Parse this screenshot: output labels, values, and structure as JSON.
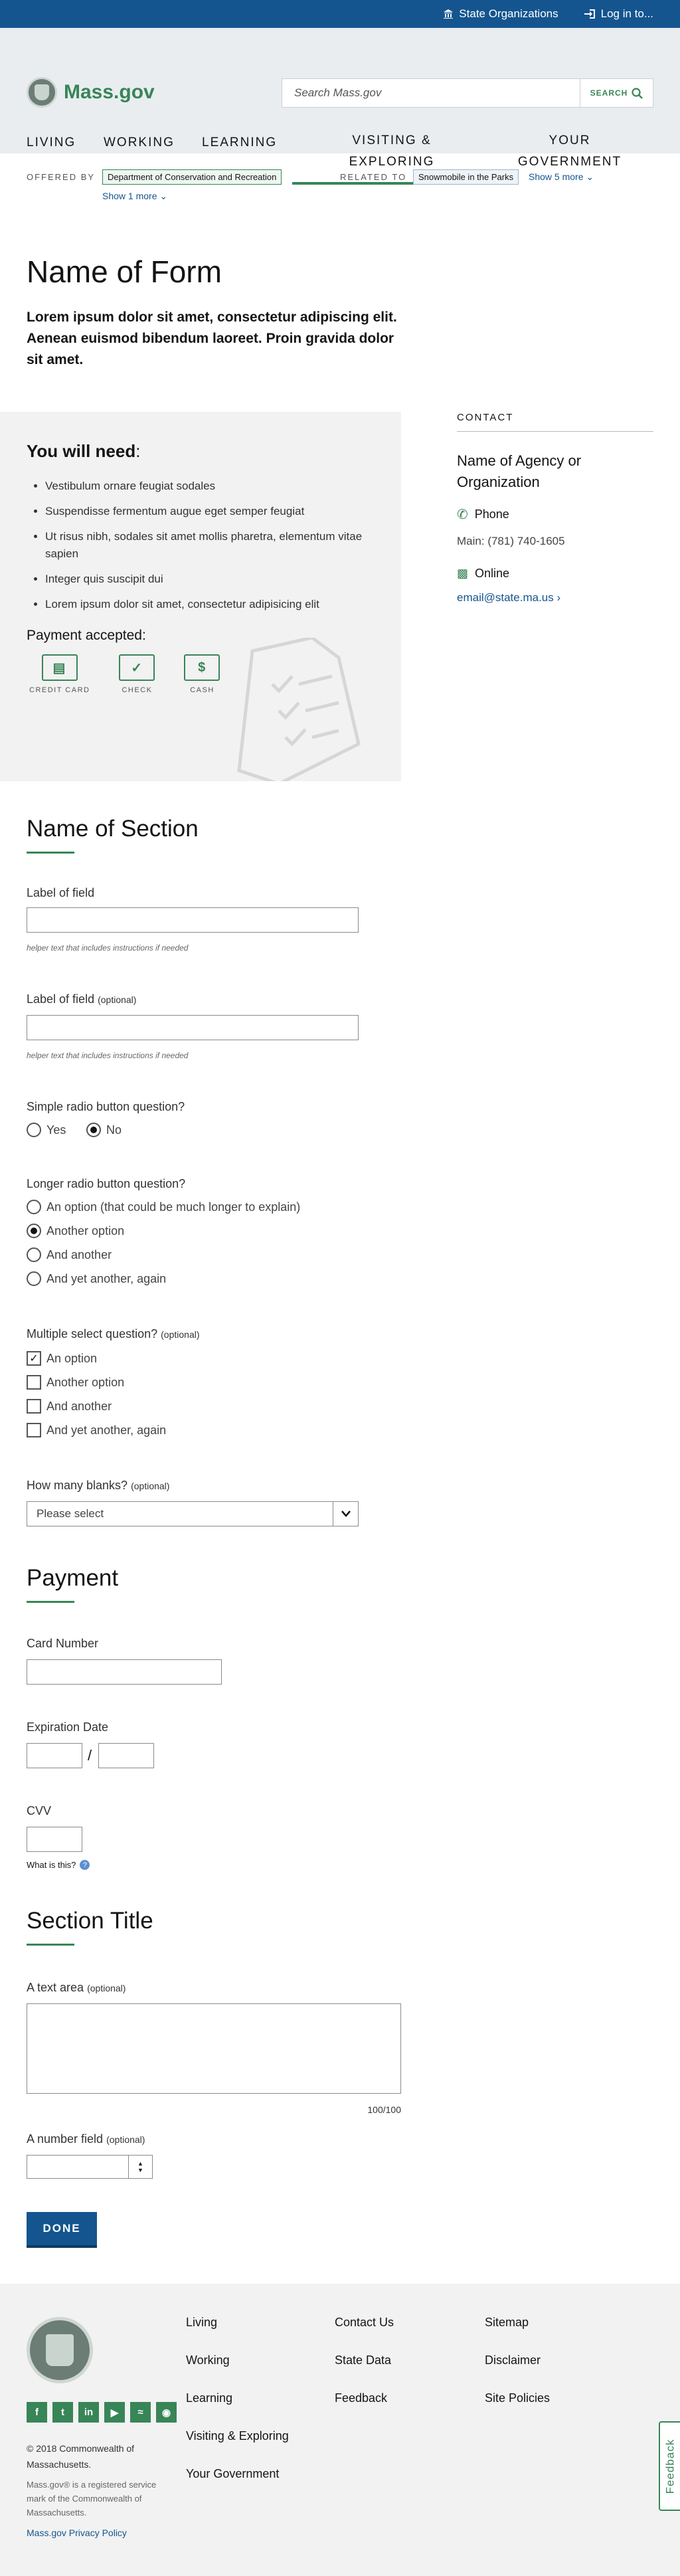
{
  "utility": {
    "state_orgs": "State Organizations",
    "login": "Log in to..."
  },
  "header": {
    "logo_text": "Mass.gov",
    "search_placeholder": "Search Mass.gov",
    "search_button": "SEARCH",
    "nav": [
      "LIVING",
      "WORKING",
      "LEARNING",
      "VISITING & EXPLORING",
      "YOUR GOVERNMENT"
    ]
  },
  "offered": {
    "label": "OFFERED BY",
    "org": "Department of Conservation and Recreation",
    "show_more": "Show 1 more",
    "related_label": "RELATED TO",
    "related": "Snowmobile in the Parks",
    "related_more": "Show 5 more"
  },
  "page": {
    "title": "Name of Form",
    "intro": "Lorem ipsum dolor sit amet, consectetur adipiscing elit. Aenean euismod bibendum laoreet. Proin gravida dolor sit amet."
  },
  "need": {
    "title": "You will need",
    "items": [
      "Vestibulum ornare feugiat sodales",
      "Suspendisse fermentum augue eget semper feugiat",
      "Ut risus nibh, sodales sit amet mollis pharetra, elementum vitae sapien",
      "Integer quis suscipit dui",
      "Lorem ipsum dolor sit amet, consectetur adipisicing elit"
    ],
    "payment_title": "Payment accepted",
    "payments": [
      "CREDIT CARD",
      "CHECK",
      "CASH"
    ]
  },
  "contact": {
    "title": "CONTACT",
    "agency": "Name of Agency or Organization",
    "phone_label": "Phone",
    "main_label": "Main:",
    "main_number": "(781) 740-1605",
    "online_label": "Online",
    "email": "email@state.ma.us"
  },
  "form": {
    "section1": "Name of Section",
    "field1_label": "Label of field",
    "field1_helper": "helper text that includes instructions if needed",
    "field2_label": "Label of field",
    "optional": "(optional)",
    "field2_helper": "helper text that includes instructions if needed",
    "simple_radio_q": "Simple radio button question?",
    "simple_radio_opts": [
      "Yes",
      "No"
    ],
    "long_radio_q": "Longer radio button question?",
    "long_radio_opts": [
      "An option (that could be much longer to explain)",
      "Another option",
      "And another",
      "And yet another, again"
    ],
    "multi_q": "Multiple select question?",
    "multi_opts": [
      "An option",
      "Another option",
      "And another",
      "And yet another, again"
    ],
    "blanks_q": "How many blanks?",
    "blanks_value": "Please select",
    "payment_section": "Payment",
    "card_label": "Card Number",
    "exp_label": "Expiration Date",
    "exp_sep": "/",
    "cvv_label": "CVV",
    "cvv_help": "What is this?",
    "section3": "Section Title",
    "textarea_label": "A text area",
    "textarea_count": "100/100",
    "number_label": "A number field",
    "done": "DONE"
  },
  "footer": {
    "col1": [
      "Living",
      "Working",
      "Learning",
      "Visiting & Exploring",
      "Your Government"
    ],
    "col2": [
      "Contact Us",
      "State Data",
      "Feedback"
    ],
    "col3": [
      "Sitemap",
      "Disclaimer",
      "Site Policies"
    ],
    "copyright": "© 2018 Commonwealth of Massachusetts.",
    "trademark": "Mass.gov® is a registered service mark of the Commonwealth of Massachusetts.",
    "privacy": "Mass.gov Privacy Policy",
    "feedback_tab": "Feedback"
  },
  "colors": {
    "brand_blue": "#14558f",
    "brand_green": "#388557"
  }
}
